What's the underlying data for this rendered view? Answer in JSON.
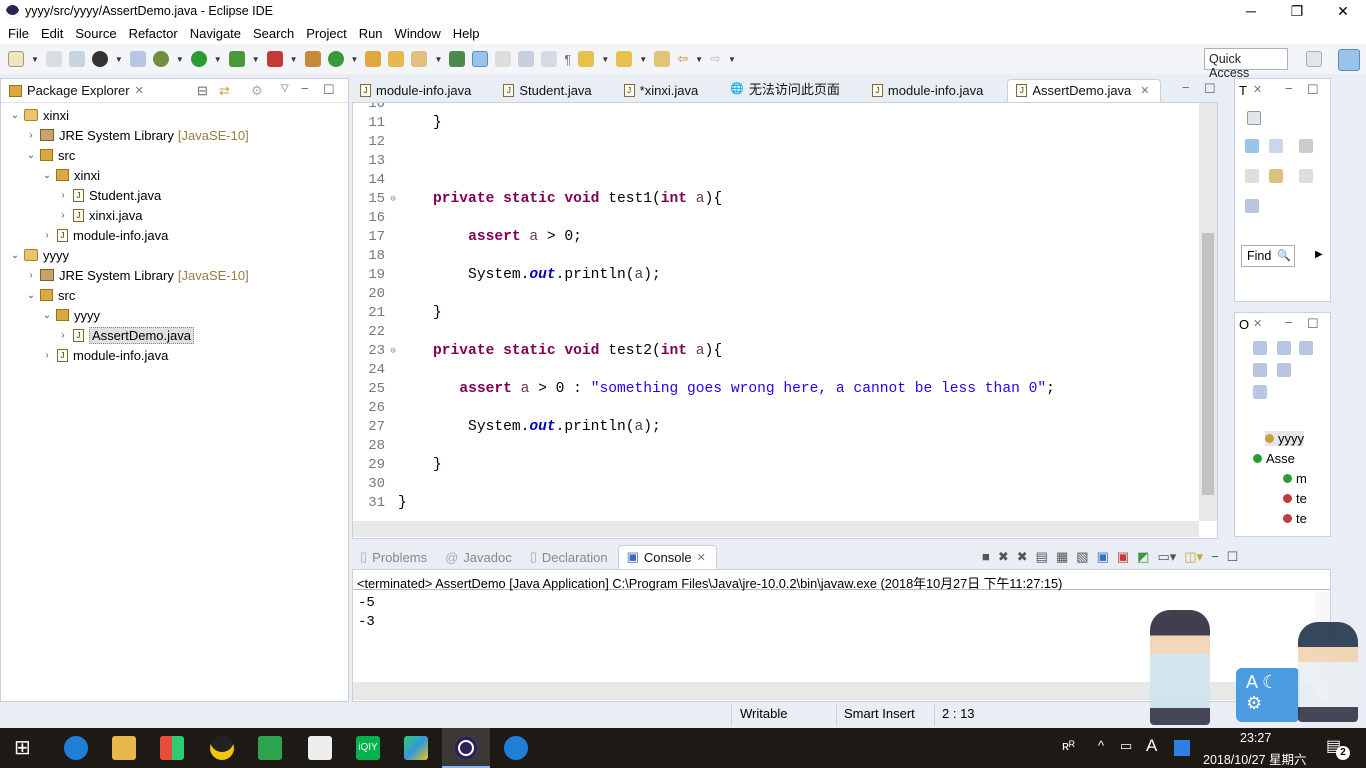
{
  "window": {
    "title": "yyyy/src/yyyy/AssertDemo.java - Eclipse IDE",
    "controls": [
      "minimize",
      "restore",
      "close"
    ]
  },
  "menu": [
    "File",
    "Edit",
    "Source",
    "Refactor",
    "Navigate",
    "Search",
    "Project",
    "Run",
    "Window",
    "Help"
  ],
  "toolbar": {
    "quick_access": "Quick Access"
  },
  "package_explorer": {
    "title": "Package Explorer",
    "tree": [
      {
        "label": "xinxi",
        "depth": 0,
        "kind": "project",
        "expanded": true
      },
      {
        "label": "JRE System Library",
        "suffix": "[JavaSE-10]",
        "depth": 1,
        "kind": "library",
        "expanded": false
      },
      {
        "label": "src",
        "depth": 1,
        "kind": "folder",
        "expanded": true
      },
      {
        "label": "xinxi",
        "depth": 2,
        "kind": "package",
        "expanded": true
      },
      {
        "label": "Student.java",
        "depth": 3,
        "kind": "java",
        "expanded": false
      },
      {
        "label": "xinxi.java",
        "depth": 3,
        "kind": "java",
        "expanded": false
      },
      {
        "label": "module-info.java",
        "depth": 2,
        "kind": "java",
        "expanded": false
      },
      {
        "label": "yyyy",
        "depth": 0,
        "kind": "project",
        "expanded": true
      },
      {
        "label": "JRE System Library",
        "suffix": "[JavaSE-10]",
        "depth": 1,
        "kind": "library",
        "expanded": false
      },
      {
        "label": "src",
        "depth": 1,
        "kind": "folder",
        "expanded": true
      },
      {
        "label": "yyyy",
        "depth": 2,
        "kind": "package",
        "expanded": true
      },
      {
        "label": "AssertDemo.java",
        "depth": 3,
        "kind": "java",
        "expanded": false,
        "selected": true
      },
      {
        "label": "module-info.java",
        "depth": 2,
        "kind": "java",
        "expanded": false
      }
    ]
  },
  "editor": {
    "tabs": [
      {
        "label": "module-info.java",
        "active": false
      },
      {
        "label": "Student.java",
        "active": false
      },
      {
        "label": "*xinxi.java",
        "active": false
      },
      {
        "label": "无法访问此页面",
        "active": false,
        "icon": "globe-icon"
      },
      {
        "label": "module-info.java",
        "active": false
      },
      {
        "label": "AssertDemo.java",
        "active": true
      }
    ],
    "lines": [
      {
        "n": "10",
        "fold": false,
        "t": []
      },
      {
        "n": "11",
        "fold": false,
        "t": [
          [
            "pl",
            "    }"
          ]
        ]
      },
      {
        "n": "12",
        "fold": false,
        "t": []
      },
      {
        "n": "13",
        "fold": false,
        "t": []
      },
      {
        "n": "14",
        "fold": false,
        "t": []
      },
      {
        "n": "15",
        "fold": true,
        "t": [
          [
            "pl",
            "    "
          ],
          [
            "kw",
            "private static void"
          ],
          [
            "pl",
            " test1("
          ],
          [
            "kw",
            "int"
          ],
          [
            "pl",
            " "
          ],
          [
            "vr",
            "a"
          ],
          [
            "pl",
            "){"
          ]
        ]
      },
      {
        "n": "16",
        "fold": false,
        "t": []
      },
      {
        "n": "17",
        "fold": false,
        "t": [
          [
            "pl",
            "        "
          ],
          [
            "kw",
            "assert"
          ],
          [
            "pl",
            " "
          ],
          [
            "vr",
            "a"
          ],
          [
            "pl",
            " > 0;"
          ]
        ]
      },
      {
        "n": "18",
        "fold": false,
        "t": []
      },
      {
        "n": "19",
        "fold": false,
        "t": [
          [
            "pl",
            "        System."
          ],
          [
            "fld",
            "out"
          ],
          [
            "pl",
            ".println("
          ],
          [
            "vr",
            "a"
          ],
          [
            "pl",
            ");"
          ]
        ]
      },
      {
        "n": "20",
        "fold": false,
        "t": []
      },
      {
        "n": "21",
        "fold": false,
        "t": [
          [
            "pl",
            "    }"
          ]
        ]
      },
      {
        "n": "22",
        "fold": false,
        "t": []
      },
      {
        "n": "23",
        "fold": true,
        "t": [
          [
            "pl",
            "    "
          ],
          [
            "kw",
            "private static void"
          ],
          [
            "pl",
            " test2("
          ],
          [
            "kw",
            "int"
          ],
          [
            "pl",
            " "
          ],
          [
            "vr",
            "a"
          ],
          [
            "pl",
            "){"
          ]
        ]
      },
      {
        "n": "24",
        "fold": false,
        "t": []
      },
      {
        "n": "25",
        "fold": false,
        "t": [
          [
            "pl",
            "       "
          ],
          [
            "kw",
            "assert"
          ],
          [
            "pl",
            " "
          ],
          [
            "vr",
            "a"
          ],
          [
            "pl",
            " > 0 : "
          ],
          [
            "str",
            "\"something goes wrong here, a cannot be less than 0\""
          ],
          [
            "pl",
            ";"
          ]
        ]
      },
      {
        "n": "26",
        "fold": false,
        "t": []
      },
      {
        "n": "27",
        "fold": false,
        "t": [
          [
            "pl",
            "        System."
          ],
          [
            "fld",
            "out"
          ],
          [
            "pl",
            ".println("
          ],
          [
            "vr",
            "a"
          ],
          [
            "pl",
            ");"
          ]
        ]
      },
      {
        "n": "28",
        "fold": false,
        "t": []
      },
      {
        "n": "29",
        "fold": false,
        "t": [
          [
            "pl",
            "    }"
          ]
        ]
      },
      {
        "n": "30",
        "fold": false,
        "t": []
      },
      {
        "n": "31",
        "fold": false,
        "t": [
          [
            "pl",
            "}"
          ]
        ]
      }
    ]
  },
  "type_panel": {
    "title": "T",
    "find": "Find"
  },
  "outline_panel": {
    "title": "O",
    "items": [
      "yyyy",
      "Asse",
      "m",
      "te",
      "te"
    ]
  },
  "console": {
    "tabs": [
      {
        "label": "Problems",
        "active": false
      },
      {
        "label": "Javadoc",
        "active": false
      },
      {
        "label": "Declaration",
        "active": false
      },
      {
        "label": "Console",
        "active": true
      }
    ],
    "header": "<terminated> AssertDemo [Java Application] C:\\Program Files\\Java\\jre-10.0.2\\bin\\javaw.exe (2018年10月27日 下午11:27:15)",
    "output": [
      "-5",
      "-3"
    ]
  },
  "status": {
    "writable": "Writable",
    "insert_mode": "Smart Insert",
    "position": "2 : 13"
  },
  "taskbar": {
    "time": "23:27",
    "date": "2018/10/27 星期六",
    "ime": "A",
    "notifications": "2"
  },
  "colors": {
    "keyword": "#7f0055",
    "string": "#2a00ff",
    "field": "#0000c0",
    "accent": "#1e6fc7"
  }
}
